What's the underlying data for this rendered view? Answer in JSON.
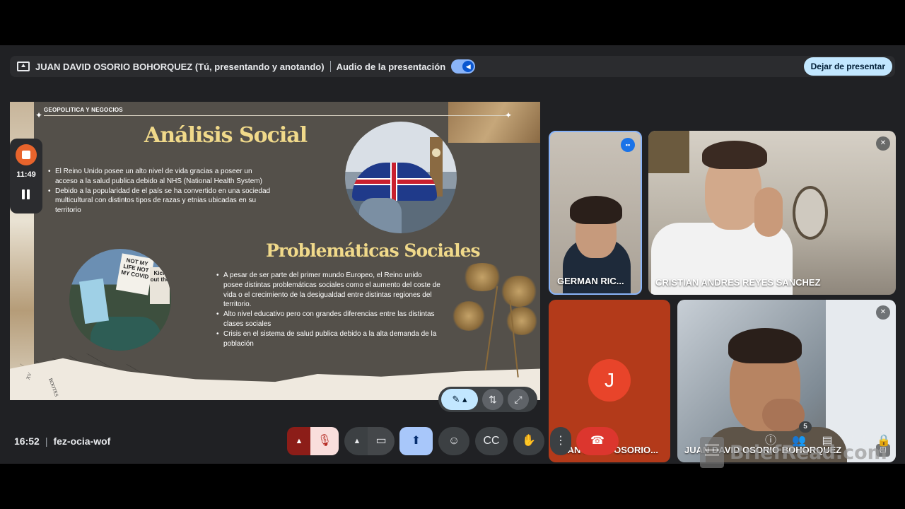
{
  "presenting_bar": {
    "presenter_status": "JUAN DAVID OSORIO BOHORQUEZ (Tú, presentando y anotando)",
    "audio_label": "Audio de la presentación",
    "stop_button": "Dejar de presentar"
  },
  "recording": {
    "elapsed": "11:49"
  },
  "slide": {
    "tag": "GEOPOLITICA Y NEGOCIOS",
    "heading1": "Análisis Social",
    "bullets1": [
      "El Reino Unido posee un alto nivel de vida gracias a poseer un acceso a la salud publica debido al NHS (National Health System)",
      "Debido a la popularidad de el país se ha convertido en una sociedad multicultural con distintos tipos de razas y etnias ubicadas en su territorio"
    ],
    "heading2": "Problemáticas Sociales",
    "bullets2": [
      "A pesar de ser parte del primer mundo Europeo, el Reino unido posee distintas problemáticas sociales como el aumento del coste de vida o el crecimiento de la desigualdad entre distintas regiones del territorio.",
      "Alto nivel educativo pero con grandes diferencias entre las distintas clases sociales",
      "Crisis en el sistema de salud publica debido a la alta demanda de la población"
    ],
    "protest_signs": [
      "NOT MY LIFE NOT MY COVID",
      "Kick out the"
    ],
    "map_words": [
      "XV",
      "BOOTES"
    ]
  },
  "participants": [
    {
      "name": "GERMAN RIC...",
      "state": "speaking"
    },
    {
      "name": "CRISTIAN ANDRES REYES SANCHEZ",
      "state": "muted"
    },
    {
      "name": "JUAN DAVID OSORIO...",
      "avatar_letter": "J",
      "state": "camera-off"
    },
    {
      "name": "JUAN DAVID OSORIO BOHORQUEZ",
      "state": "muted"
    }
  ],
  "bottom_bar": {
    "time": "16:52",
    "meeting_code": "fez-ocia-wof",
    "people_count": "5"
  },
  "watermark": "BriefRead.com",
  "colors": {
    "leave": "#dc362e",
    "present_active": "#a8c7fa",
    "heading_gold": "#f0d98a",
    "record": "#e8642c"
  }
}
